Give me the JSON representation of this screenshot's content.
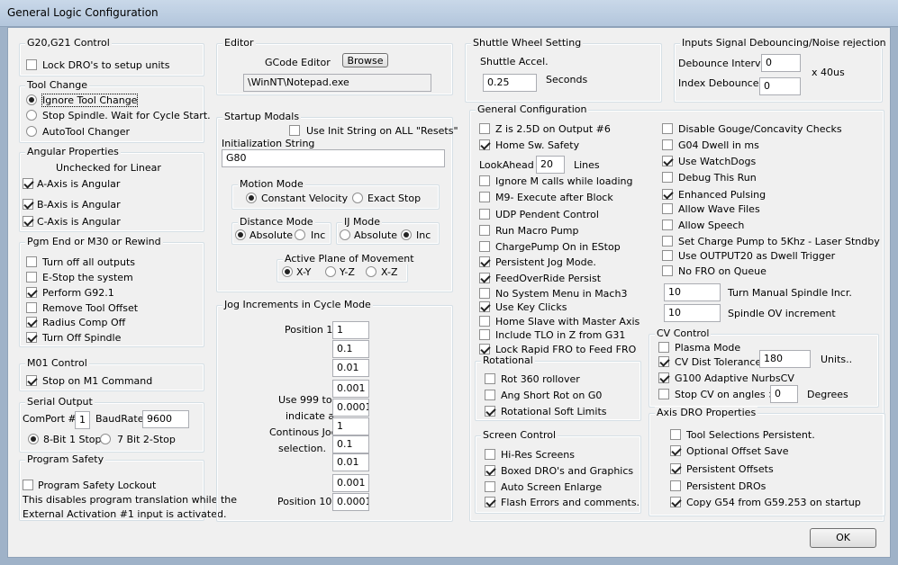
{
  "title": "General Logic Configuration",
  "g2021": {
    "legend": "G20,G21 Control",
    "lock": "Lock DRO's to setup units"
  },
  "toolchange": {
    "legend": "Tool Change",
    "ignore": "Ignore Tool Change",
    "stop": "Stop Spindle. Wait for Cycle Start.",
    "auto": "AutoTool Changer"
  },
  "angular": {
    "legend": "Angular Properties",
    "note": "Unchecked for Linear",
    "a": "A-Axis is Angular",
    "b": "B-Axis is Angular",
    "c": "C-Axis is Angular"
  },
  "pgmend": {
    "legend": "Pgm End or M30 or Rewind",
    "outputs": "Turn off all outputs",
    "estop": "E-Stop the system",
    "g921": "Perform G92.1",
    "remove": "Remove Tool Offset",
    "radius": "Radius Comp Off",
    "spindle": "Turn Off Spindle"
  },
  "m01": {
    "legend": "M01 Control",
    "stop": "Stop on M1 Command"
  },
  "serial": {
    "legend": "Serial Output",
    "comport_label": "ComPort #",
    "comport": "1",
    "baud_label": "BaudRate",
    "baud": "9600",
    "opt8": "8-Bit 1 Stop",
    "opt7": "7 Bit 2-Stop"
  },
  "safety": {
    "legend": "Program Safety",
    "lockout": "Program Safety Lockout",
    "note1": "This disables program translation while the",
    "note2": "External Activation #1 input is activated."
  },
  "editor": {
    "legend": "Editor",
    "label": "GCode Editor",
    "browse": "Browse",
    "path": "\\WinNT\\Notepad.exe"
  },
  "startup": {
    "legend": "Startup Modals",
    "use_init": "Use Init String on ALL \"Resets\"",
    "init_label": "Initialization String",
    "init": "G80",
    "motion": {
      "legend": "Motion Mode",
      "cv": "Constant Velocity",
      "es": "Exact Stop"
    },
    "distance": {
      "legend": "Distance Mode",
      "abs": "Absolute",
      "inc": "Inc"
    },
    "ij": {
      "legend": "IJ Mode",
      "abs": "Absolute",
      "inc": "Inc"
    },
    "plane": {
      "legend": "Active Plane of Movement",
      "xy": "X-Y",
      "yz": "Y-Z",
      "xz": "X-Z"
    }
  },
  "jog": {
    "legend": "Jog Increments in Cycle Mode",
    "pos1": "Position 1",
    "pos10": "Position 10",
    "note1": "Use 999 to",
    "note2": "indicate a",
    "note3": "Continous Jog",
    "note4": "selection.",
    "values": [
      "1",
      "0.1",
      "0.01",
      "0.001",
      "0.0001",
      "1",
      "0.1",
      "0.01",
      "0.001",
      "0.0001"
    ]
  },
  "shuttle": {
    "legend": "Shuttle Wheel Setting",
    "accel": "Shuttle Accel.",
    "value": "0.25",
    "unit": "Seconds"
  },
  "debounce": {
    "legend": "Inputs Signal Debouncing/Noise rejection",
    "interval_label": "Debounce Interval",
    "interval": "0",
    "unit": "x 40us",
    "index_label": "Index Debounce",
    "index": "0"
  },
  "general": {
    "legend": "General Configuration",
    "z25": "Z is 2.5D on Output #6",
    "home": "Home Sw. Safety",
    "lookahead": "LookAhead",
    "lookahead_val": "20",
    "lines": "Lines",
    "ignore_m": "Ignore M calls while loading",
    "m9": "M9- Execute after Block",
    "udp": "UDP Pendent Control",
    "macro": "Run Macro Pump",
    "chargepump": "ChargePump On in EStop",
    "persist_jog": "Persistent Jog Mode.",
    "feedover": "FeedOverRide Persist",
    "nomenu": "No System Menu in Mach3",
    "keyclicks": "Use Key Clicks",
    "homeslave": "Home Slave with Master Axis",
    "tlo": "Include TLO in Z from G31",
    "lockrapid": "Lock Rapid FRO to Feed FRO",
    "gouge": "Disable Gouge/Concavity Checks",
    "g04": "G04 Dwell in ms",
    "watchdogs": "Use WatchDogs",
    "debug": "Debug This Run",
    "pulsing": "Enhanced Pulsing",
    "wave": "Allow Wave Files",
    "speech": "Allow Speech",
    "charge5k": "Set Charge Pump to 5Khz  - Laser Stndby",
    "output20": "Use OUTPUT20 as Dwell Trigger",
    "nofro": "No FRO on Queue",
    "spindle_incr_val": "10",
    "spindle_incr": "Turn Manual Spindle Incr.",
    "spindle_ov_val": "10",
    "spindle_ov": "Spindle OV increment"
  },
  "rotational": {
    "legend": "Rotational",
    "rot360": "Rot 360 rollover",
    "angshort": "Ang Short Rot on G0",
    "soft": "Rotational Soft Limits"
  },
  "screen": {
    "legend": "Screen Control",
    "hires": "Hi-Res Screens",
    "boxed": "Boxed DRO's and Graphics",
    "enlarge": "Auto Screen Enlarge",
    "flash": "Flash Errors and comments."
  },
  "cv": {
    "legend": "CV Control",
    "plasma": "Plasma Mode",
    "tol": "CV Dist Tolerance",
    "tol_val": "180",
    "units": "Units..",
    "g100": "G100 Adaptive NurbsCV",
    "stop": "Stop CV on angles >",
    "stop_val": "0",
    "degrees": "Degrees"
  },
  "axisdro": {
    "legend": "Axis DRO Properties",
    "tool": "Tool Selections Persistent.",
    "optional": "Optional Offset Save",
    "persist_off": "Persistent Offsets",
    "persist_dro": "Persistent DROs",
    "copy": "Copy G54 from G59.253 on startup"
  },
  "ok": "OK"
}
